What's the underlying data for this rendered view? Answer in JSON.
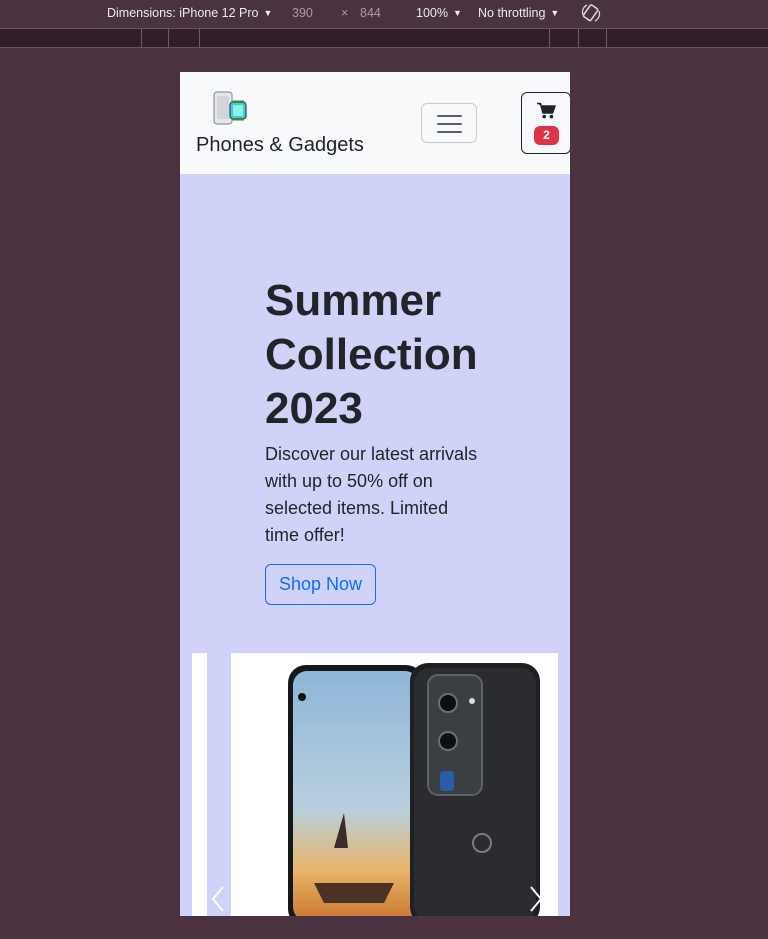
{
  "devtools": {
    "dimensions_label": "Dimensions: iPhone 12 Pro",
    "width_value": "390",
    "times": "×",
    "height_value": "844",
    "zoom": "100%",
    "throttling": "No throttling",
    "caret": "▼"
  },
  "navbar": {
    "brand_name": "Phones & Gadgets",
    "cart_count": "2"
  },
  "hero": {
    "title": "Summer Collection 2023",
    "description": "Discover our latest arrivals with up to 50% off on selected items. Limited time offer!",
    "cta_label": "Shop Now"
  },
  "colors": {
    "hero_background": "#d0d3f7",
    "primary": "#0d6efd",
    "badge": "#dc3545",
    "devtools_background": "#4b3241"
  },
  "icons": {
    "brand": "phone-watch-logo-icon",
    "menu": "hamburger-icon",
    "cart": "shopping-cart-icon",
    "rotate": "rotate-device-icon",
    "prev": "chevron-left-icon",
    "next": "chevron-right-icon"
  }
}
